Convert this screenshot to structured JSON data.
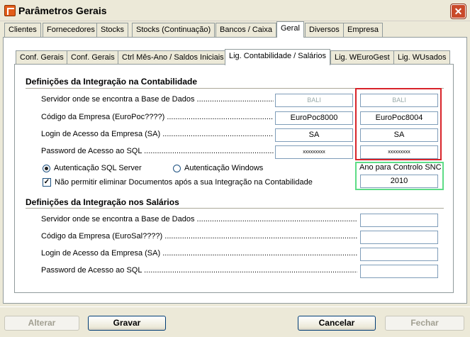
{
  "window": {
    "title": "Parâmetros Gerais",
    "close_label": "✕"
  },
  "top_tabs": [
    {
      "label": "Clientes"
    },
    {
      "label": "Fornecedores"
    },
    {
      "label": "Stocks"
    },
    {
      "label": "Stocks (Continuação)"
    },
    {
      "label": "Bancos / Caixa"
    },
    {
      "label": "Geral"
    },
    {
      "label": "Diversos"
    },
    {
      "label": "Empresa"
    }
  ],
  "sub_tabs": [
    {
      "label": "Conf. Gerais"
    },
    {
      "label": "Conf. Gerais"
    },
    {
      "label": "Ctrl Mês-Ano / Saldos Iniciais"
    },
    {
      "label": "Lig. Contabilidade / Salários"
    },
    {
      "label": "Lig. WEuroGest"
    },
    {
      "label": "Lig. WUsados"
    }
  ],
  "contab": {
    "title": "Definições da Integração na Contabilidade",
    "rows": [
      {
        "label": "Servidor onde se encontra a Base de Dados ..........................................",
        "value1": "BALI",
        "value2": "BALI"
      },
      {
        "label": "Código da Empresa  (EuroPoc????) ........................................................",
        "value1": "EuroPoc8000",
        "value2": "EuroPoc8004"
      },
      {
        "label": "Login de Acesso da Empresa  (SA) ..........................................................",
        "value1": "SA",
        "value2": "SA"
      },
      {
        "label": "Password de Acesso ao SQL ..................................................................",
        "value1": "xxxxxxxxx",
        "value2": "xxxxxxxxx"
      }
    ],
    "auth_sql": "Autenticação SQL Server",
    "auth_windows": "Autenticação Windows",
    "no_delete": "Não permitir eliminar Documentos após a sua Integração na Contabilidade",
    "snc_label": "Ano para Controlo SNC",
    "snc_value": "2010"
  },
  "salarios": {
    "title": "Definições da Integração nos Salários",
    "rows": [
      {
        "label": "Servidor onde se encontra a Base de Dados ......................................................................................................",
        "value": ""
      },
      {
        "label": "Código da Empresa  (EuroSal????) ...............................................................................................................",
        "value": ""
      },
      {
        "label": "Login de Acesso da Empresa  (SA) ..............................................................................................................",
        "value": ""
      },
      {
        "label": "Password de Acesso ao SQL .......................................................................................................................",
        "value": ""
      }
    ]
  },
  "buttons": {
    "alterar": "Alterar",
    "gravar": "Gravar",
    "cancelar": "Cancelar",
    "fechar": "Fechar"
  }
}
